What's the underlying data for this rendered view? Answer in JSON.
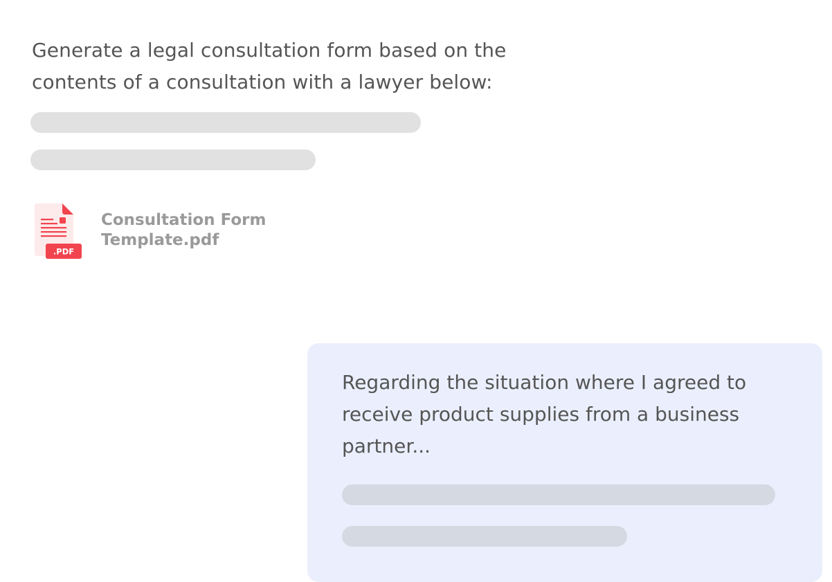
{
  "prompt": {
    "text": "Generate a legal consultation form based on the contents of a consultation with a lawyer below:"
  },
  "attachment": {
    "icon": "pdf-file-icon",
    "badge": ".PDF",
    "file_name": "Consultation Form Template.pdf"
  },
  "reply_bubble": {
    "text": "Regarding the situation where I agreed to receive product supplies from a business partner..."
  },
  "colors": {
    "text": "#555555",
    "skeleton": "#e1e1e1",
    "bubble_background": "#ebeffd",
    "bubble_skeleton": "#d5d9e1",
    "pdf_accent": "#f2444e",
    "pdf_page": "#fdeaea",
    "file_name": "#9a9a9a"
  }
}
